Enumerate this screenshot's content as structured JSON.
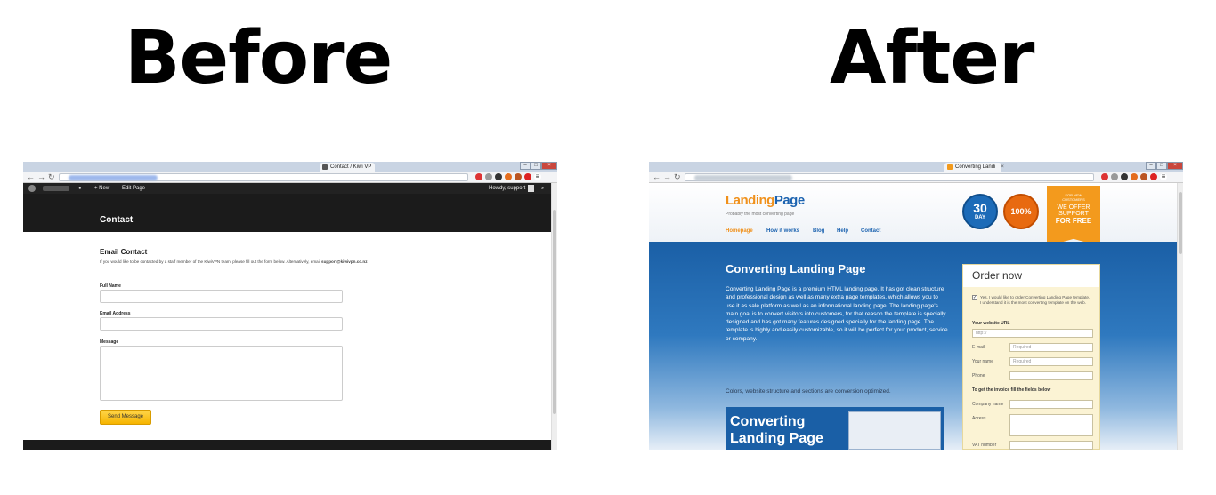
{
  "headings": {
    "before": "Before",
    "after": "After"
  },
  "before": {
    "tab_title": "Contact / Kiwi VP",
    "toolbar": {
      "new": "New",
      "edit_page": "Edit Page",
      "howdy": "Howdy, support"
    },
    "page_title": "Contact",
    "section_title": "Email Contact",
    "intro": "If you would like to be contacted by a staff member of the KiwiVPN team, please fill out the form below. Alternatively, email",
    "intro_email": "support@kiwivpn.co.nz",
    "fields": {
      "full_name": "Full Name",
      "email": "Email Address",
      "message": "Message"
    },
    "submit": "Send Message"
  },
  "after": {
    "tab_title": "Converting Landi",
    "logo_landing": "Landing",
    "logo_page": "Page",
    "tagline": "Probably the most converting page",
    "nav": [
      "Homepage",
      "How it works",
      "Blog",
      "Help",
      "Contact"
    ],
    "badge_30": {
      "num": "30",
      "unit": "DAY"
    },
    "badge_100": "100%",
    "ribbon": {
      "line1": "FOR NEW",
      "line2": "CUSTOMERS",
      "line3": "WE OFFER",
      "line4": "SUPPORT",
      "line5": "FOR FREE"
    },
    "hero_title": "Converting Landing Page",
    "hero_text": "Converting Landing Page is a premium HTML landing page. It has got clean structure and professional design as well as many extra page templates, which allows you to use it as sale platform as well as an informational landing page. The landing page's main goal is to convert visitors into customers, for that reason the template is specially designed and has got many features designed specially for the landing page. The template is highly and easily customizable, so it will be perfect for your product, service or company.",
    "sub_text": "Colors, website structure and sections are conversion optimized.",
    "promo_line1": "Converting",
    "promo_line2": "Landing Page",
    "order": {
      "title": "Order now",
      "checkbox_text": "Yes, I would like to order Converting Landing Page template. I understand it is the most converting template on the web.",
      "url_label": "Your website URL",
      "url_placeholder": "http://",
      "email_label": "E-mail",
      "name_label": "Your name",
      "phone_label": "Phone",
      "required": "Required",
      "invoice_label": "To get the invoice fill the fields below",
      "company_label": "Company name",
      "address_label": "Adress",
      "vat_label": "VAT number"
    }
  }
}
